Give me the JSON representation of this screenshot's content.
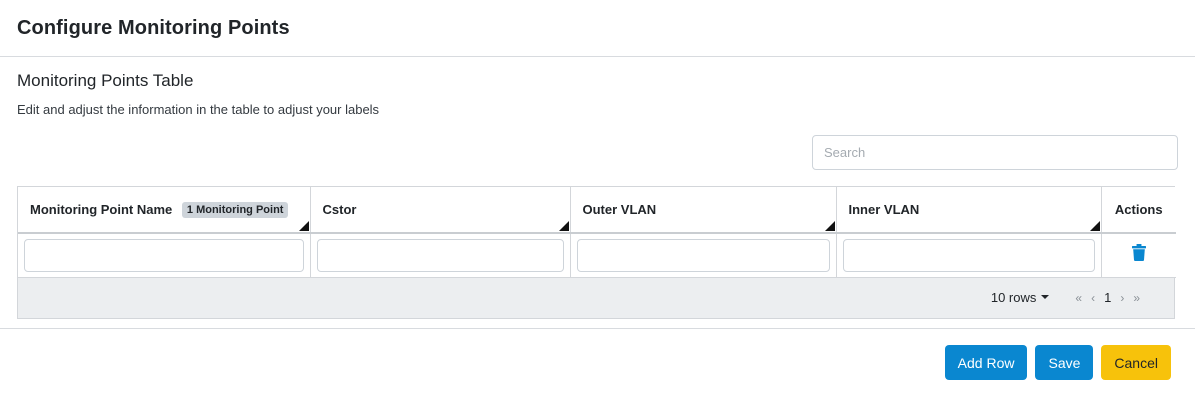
{
  "modal": {
    "title": "Configure Monitoring Points"
  },
  "section": {
    "title": "Monitoring Points Table",
    "description": "Edit and adjust the information in the table to adjust your labels"
  },
  "search": {
    "placeholder": "Search",
    "value": ""
  },
  "table": {
    "columns": [
      {
        "label": "Monitoring Point Name",
        "badge": "1 Monitoring Point",
        "sortable": true
      },
      {
        "label": "Cstor",
        "sortable": true
      },
      {
        "label": "Outer VLAN",
        "sortable": true
      },
      {
        "label": "Inner VLAN",
        "sortable": true
      },
      {
        "label": "Actions",
        "sortable": false
      }
    ],
    "rows": [
      {
        "monitoring_point_name": "",
        "cstor": "",
        "outer_vlan": "",
        "inner_vlan": "",
        "action_icon": "trash-icon"
      }
    ]
  },
  "pagination": {
    "rows_per_page": "10 rows",
    "first": "«",
    "prev": "‹",
    "current_page": "1",
    "next": "›",
    "last": "»"
  },
  "buttons": {
    "add_row": "Add Row",
    "save": "Save",
    "cancel": "Cancel"
  },
  "colors": {
    "primary": "#0a87d0",
    "warning": "#f7c20b",
    "trash_icon": "#0a87d0"
  }
}
